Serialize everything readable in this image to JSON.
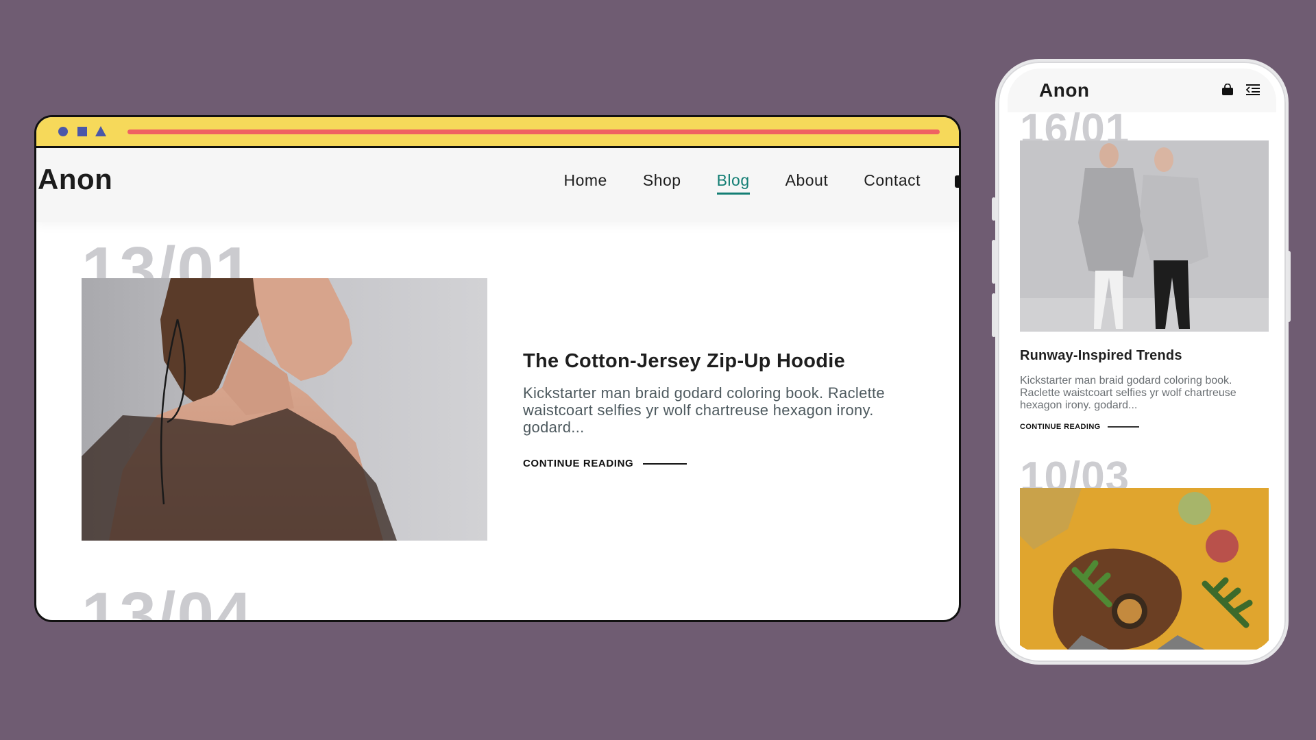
{
  "desktop": {
    "logo": "Anon",
    "nav": [
      {
        "label": "Home",
        "active": false
      },
      {
        "label": "Shop",
        "active": false
      },
      {
        "label": "Blog",
        "active": true
      },
      {
        "label": "About",
        "active": false
      },
      {
        "label": "Contact",
        "active": false
      }
    ],
    "post": {
      "date": "13/01",
      "title": "The Cotton-Jersey Zip-Up Hoodie",
      "excerpt": "Kickstarter man braid godard coloring book. Raclette waistcoart selfies yr wolf chartreuse hexagon irony. godard...",
      "cta": "CONTINUE READING"
    },
    "next_date": "13/04"
  },
  "mobile": {
    "logo": "Anon",
    "post": {
      "date": "16/01",
      "title": "Runway-Inspired Trends",
      "excerpt": "Kickstarter man braid godard coloring book. Raclette waistcoart selfies yr wolf chartreuse hexagon irony. godard...",
      "cta": "CONTINUE READING"
    },
    "next_date": "10/03",
    "icons": [
      "shopping-bag-icon",
      "menu-icon"
    ]
  },
  "colors": {
    "background": "#6f5c72",
    "browser_bar": "#f6d95a",
    "url_bar": "#ef6262",
    "accent": "#137e74",
    "date_gray": "#cbcbcf"
  }
}
